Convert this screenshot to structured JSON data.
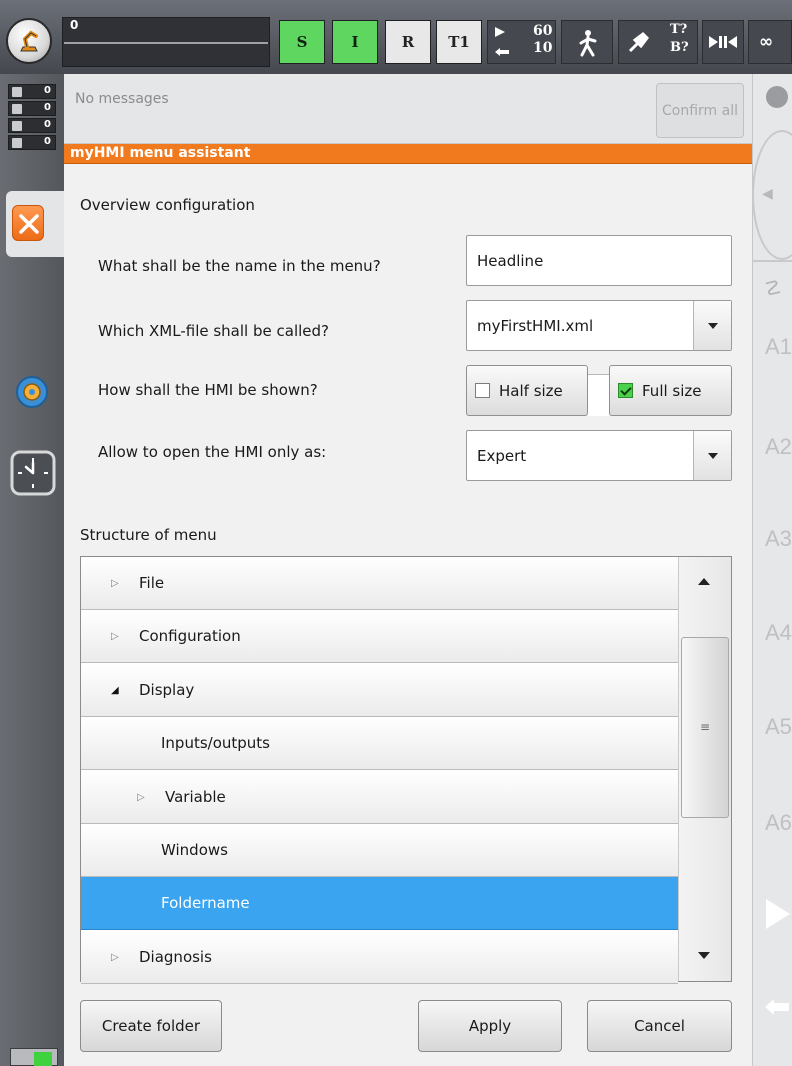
{
  "topbar": {
    "progress_value": "0",
    "mode_s": "S",
    "mode_i": "I",
    "mode_r": "R",
    "mode_t1": "T1",
    "override_program": "60",
    "override_jog": "10",
    "tool_t": "T?",
    "tool_b": "B?",
    "infinity": "∞",
    "colors": {
      "mode_active": "#5fd65f",
      "bar_bg": "#45484e"
    }
  },
  "messages": {
    "counters": [
      "0",
      "0",
      "0",
      "0"
    ],
    "text": "No messages",
    "confirm_all": "Confirm all"
  },
  "dialog": {
    "title": "myHMI menu assistant",
    "accent_color": "#f07a1d",
    "overview_title": "Overview configuration",
    "q_name": "What shall be the name in the menu?",
    "q_xml": "Which XML-file shall be called?",
    "q_shown": "How shall the HMI be shown?",
    "q_allow": "Allow to open the HMI only as:",
    "name_value": "Headline",
    "xml_value": "myFirstHMI.xml",
    "half_size": "Half size",
    "half_checked": false,
    "full_size": "Full size",
    "full_checked": true,
    "user_level": "Expert",
    "structure_title": "Structure of menu",
    "tree": [
      {
        "label": "File",
        "expander": "▷",
        "level": 0
      },
      {
        "label": "Configuration",
        "expander": "▷",
        "level": 0
      },
      {
        "label": "Display",
        "expander": "◢",
        "level": 0
      },
      {
        "label": "Inputs/outputs",
        "expander": "",
        "level": 1
      },
      {
        "label": "Variable",
        "expander": "▷",
        "level": 1
      },
      {
        "label": "Windows",
        "expander": "",
        "level": 1
      },
      {
        "label": "Foldername",
        "expander": "",
        "level": 1,
        "selected": true
      },
      {
        "label": "Diagnosis",
        "expander": "▷",
        "level": 0
      }
    ],
    "selected_color": "#3aa4f0",
    "create_folder": "Create folder",
    "apply": "Apply",
    "cancel": "Cancel"
  },
  "rightbar": {
    "axes": [
      "A1",
      "A2",
      "A3",
      "A4",
      "A5",
      "A6"
    ]
  }
}
